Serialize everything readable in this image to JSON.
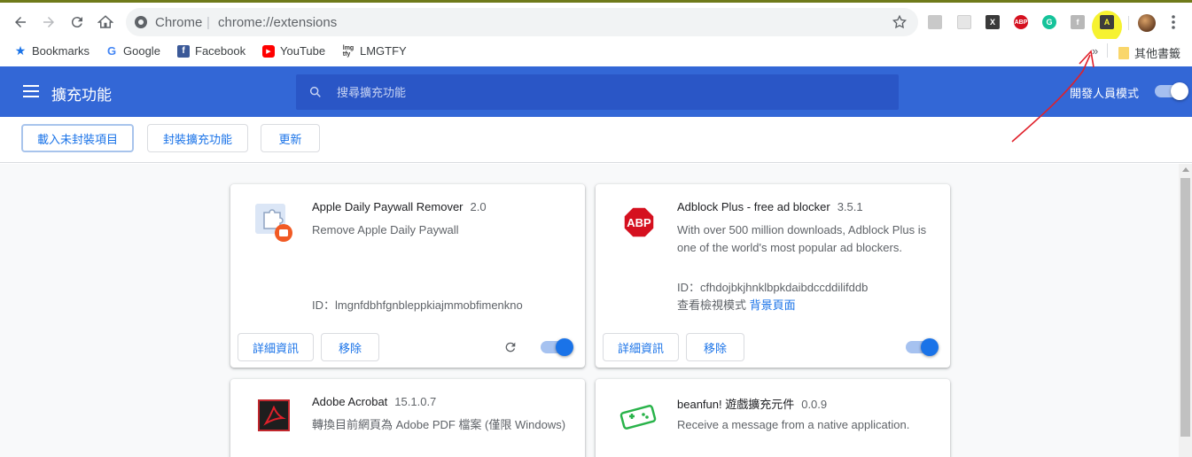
{
  "browser": {
    "omnibox_site": "Chrome",
    "omnibox_url": "chrome://extensions",
    "bookmarks": [
      {
        "label": "Bookmarks"
      },
      {
        "label": "Google"
      },
      {
        "label": "Facebook"
      },
      {
        "label": "YouTube"
      },
      {
        "label": "LMGTFY"
      }
    ],
    "other_bookmarks": "其他書籤",
    "overflow": "»",
    "ext_icons": [
      {
        "name": "acrobat-ext-icon",
        "glyph": ""
      },
      {
        "name": "ticket-ext-icon",
        "glyph": ""
      },
      {
        "name": "x-ext-icon",
        "glyph": "X"
      },
      {
        "name": "abp-ext-icon",
        "glyph": "ABP"
      },
      {
        "name": "grammarly-ext-icon",
        "glyph": "G"
      },
      {
        "name": "facebook-ext-icon",
        "glyph": "f"
      },
      {
        "name": "a-ext-icon",
        "glyph": "A"
      }
    ]
  },
  "header": {
    "title": "擴充功能",
    "search_placeholder": "搜尋擴充功能",
    "dev_mode_label": "開發人員模式",
    "dev_mode_on": true
  },
  "toolbar": {
    "load_unpacked": "載入未封裝項目",
    "pack_extension": "封裝擴充功能",
    "update": "更新"
  },
  "extensions": [
    {
      "name": "Apple Daily Paywall Remover",
      "version": "2.0",
      "description": "Remove Apple Daily Paywall",
      "id_label": "ID：lmgnfdbhfgnbleppkiajmmobfimenkno",
      "details_label": "詳細資訊",
      "remove_label": "移除",
      "enabled": true
    },
    {
      "name": "Adblock Plus - free ad blocker",
      "version": "3.5.1",
      "description": "With over 500 million downloads, Adblock Plus is one of the world's most popular ad blockers.",
      "id_label": "ID：cfhdojbkjhnklbpkdaibdccddilifddb",
      "inspect_label": "查看檢視模式",
      "inspect_link": "背景頁面",
      "details_label": "詳細資訊",
      "remove_label": "移除",
      "enabled": true
    },
    {
      "name": "Adobe Acrobat",
      "version": "15.1.0.7",
      "description": "轉換目前網頁為 Adobe PDF 檔案 (僅限 Windows)"
    },
    {
      "name": "beanfun! 遊戲擴充元件",
      "version": "0.0.9",
      "description": "Receive a message from a native application."
    }
  ],
  "colors": {
    "header_bg": "#3367d6",
    "accent": "#1a73e8",
    "highlight": "#f6f230",
    "annotation": "#e0202a"
  }
}
